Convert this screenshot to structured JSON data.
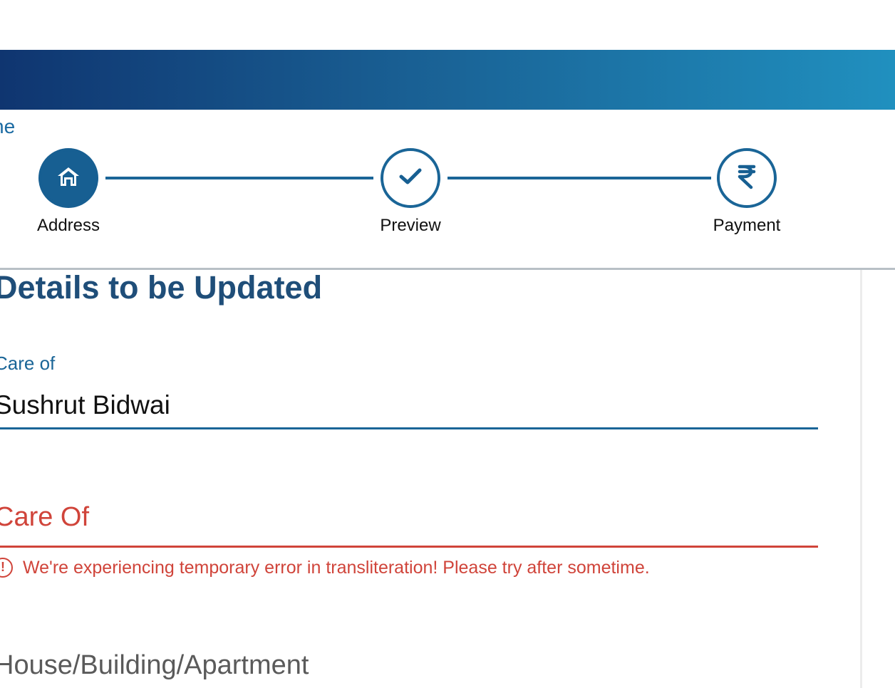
{
  "header": {
    "breadcrumb_fragment": "ne"
  },
  "stepper": {
    "steps": [
      {
        "label": "Address",
        "icon": "home-icon",
        "state": "active"
      },
      {
        "label": "Preview",
        "icon": "check-icon",
        "state": "pending"
      },
      {
        "label": "Payment",
        "icon": "rupee-icon",
        "state": "pending"
      }
    ]
  },
  "form": {
    "section_title": "Details to be Updated",
    "care_of": {
      "label": "Care of",
      "value": "Sushrut Bidwai"
    },
    "care_of_local": {
      "label": "Care Of",
      "error": "We're experiencing temporary error in transliteration! Please try after sometime."
    },
    "house": {
      "label": "House/Building/Apartment"
    }
  },
  "colors": {
    "primary": "#1a6597",
    "title": "#1f4e79",
    "error": "#d0443a",
    "banner_start": "#0f3570",
    "banner_end": "#2090bf"
  }
}
